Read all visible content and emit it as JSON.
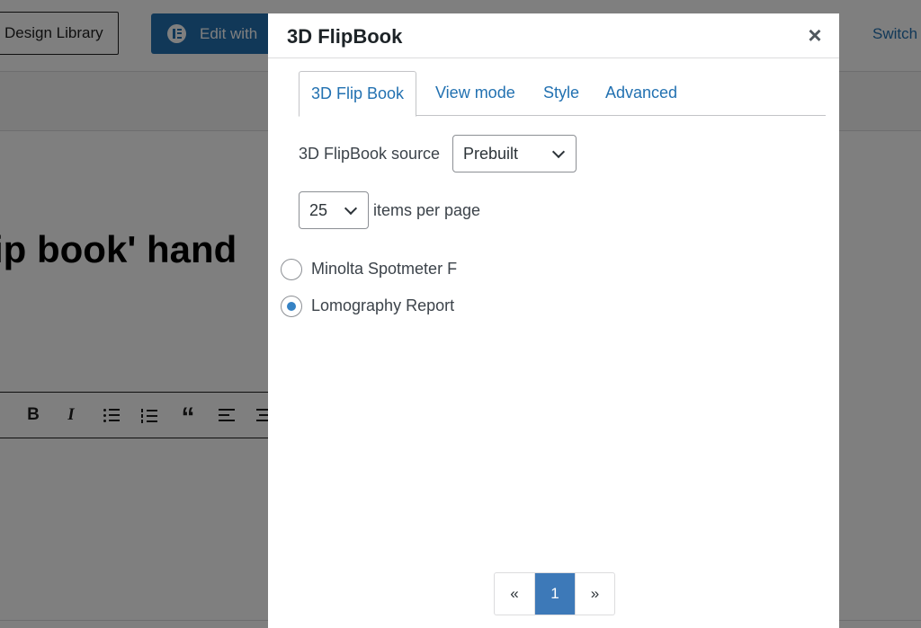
{
  "background": {
    "design_library_label": "Design Library",
    "edit_with_label": "Edit with",
    "switch_label": "Switch",
    "post_title_fragment": "ip book' hand"
  },
  "modal": {
    "title": "3D FlipBook",
    "close_symbol": "×",
    "tabs": [
      {
        "label": "3D Flip Book",
        "active": true
      },
      {
        "label": "View mode",
        "active": false
      },
      {
        "label": "Style",
        "active": false
      },
      {
        "label": "Advanced",
        "active": false
      }
    ],
    "source": {
      "label": "3D FlipBook source",
      "selected": "Prebuilt"
    },
    "per_page": {
      "selected": "25",
      "label": "items per page"
    },
    "items": [
      {
        "label": "Minolta Spotmeter F",
        "checked": false
      },
      {
        "label": "Lomography Report",
        "checked": true
      }
    ],
    "pagination": {
      "prev": "«",
      "current": "1",
      "next": "»"
    }
  },
  "colors": {
    "accent": "#2271b1",
    "radio_checked": "#3582c4",
    "pager_current": "#3d79b8"
  }
}
